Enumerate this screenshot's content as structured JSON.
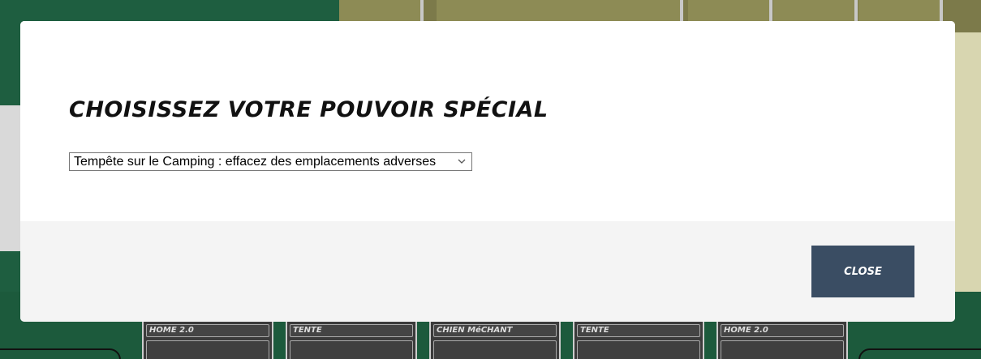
{
  "modal": {
    "title": "Choisissez votre pouvoir spécial",
    "power_select": {
      "selected": "Tempête sur le Camping : effacez des emplacements adverses"
    },
    "close_label": "Close"
  },
  "background": {
    "cards": [
      {
        "label": "HOME 2.0"
      },
      {
        "label": "TENTE"
      },
      {
        "label": "CHIEN MéCHANT"
      },
      {
        "label": "TENTE"
      },
      {
        "label": "HOME 2.0"
      }
    ]
  },
  "colors": {
    "close_button_bg": "#3a4d63",
    "footer_bg": "#f4f4f4",
    "board_green": "#1c5a3c"
  },
  "icons": {
    "select_arrow": "chevron-down-icon"
  }
}
